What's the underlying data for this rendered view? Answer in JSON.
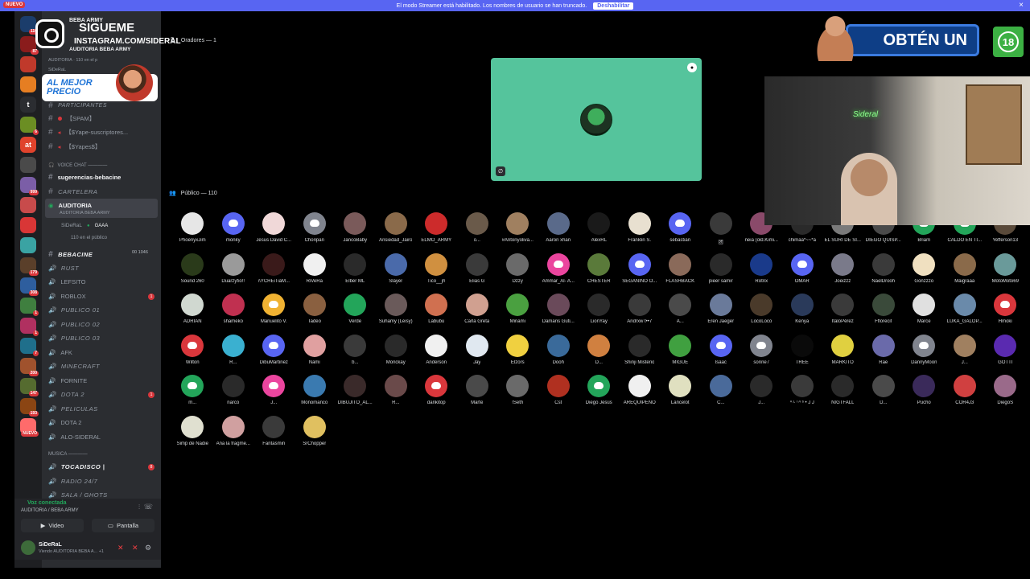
{
  "banner": {
    "badge": "NUEVO",
    "message": "El modo Streamer está habilitado. Los nombres de usuario se han truncado.",
    "button": "Deshabilitar"
  },
  "servers": [
    {
      "color": "#1b3d6b",
      "badge": "110"
    },
    {
      "color": "#8a1c1c",
      "badge": "87"
    },
    {
      "color": "#c0392b",
      "badge": ""
    },
    {
      "color": "#e67e22",
      "badge": ""
    },
    {
      "color": "#2b2d31",
      "glyph": "t",
      "badge": ""
    },
    {
      "color": "#6b8e23",
      "badge": "6"
    },
    {
      "color": "#e0432c",
      "glyph": "at",
      "badge": ""
    },
    {
      "color": "#4a4a4a",
      "badge": ""
    },
    {
      "color": "#7b5ea7",
      "badge": "999"
    },
    {
      "color": "#c84b4b",
      "badge": ""
    },
    {
      "color": "#d93636",
      "badge": ""
    },
    {
      "color": "#3aa3a3",
      "badge": ""
    },
    {
      "color": "#5a3f2a",
      "badge": "179"
    },
    {
      "color": "#2e5e9e",
      "badge": "308"
    },
    {
      "color": "#3f7f3f",
      "badge": "1"
    },
    {
      "color": "#b03060",
      "badge": "1"
    },
    {
      "color": "#1f6f8b",
      "badge": "7"
    },
    {
      "color": "#a0522d",
      "badge": "200"
    },
    {
      "color": "#556b2f",
      "badge": "147"
    },
    {
      "color": "#8b4513",
      "badge": "193"
    },
    {
      "color": "#ff6b6b",
      "badge": "NUEVO"
    }
  ],
  "overlay": {
    "follow": "SIGUEME",
    "instagram": "INSTAGRAM.COM/SIDERAL",
    "promo": "AL MEJOR PRECIO",
    "get": "OBTÉN UN",
    "age": "18"
  },
  "channels": {
    "server_name": "BEBA ARMY",
    "auditoria": "AUDITORIA BEBA ARMY",
    "auditoria_sub": "AUDITORIA  ·  110 en el p",
    "sideral": "SiDeRaL",
    "participantes": "PARTICIPANTES",
    "spam": "【SPAM】",
    "yape_subs": "【$Yape-suscriptores...",
    "yapes": "【$Yapes$】",
    "voice_cat": "VOICE CHAT ————",
    "sugerencias": "sugerencias-bebacine",
    "cartelera": "CARTELERA",
    "auditoria_ch": "AUDITORIA",
    "auditoria_ch_sub": "AUDITORIA BEBA ARMY",
    "sideral_user": "SiDeRaL",
    "gaaa": "GAAA",
    "public_count": "110 en el público",
    "bebacine": "BEBACINE",
    "bebacine_badge": "00",
    "bebacine_count": "1046",
    "rust": "RUST",
    "lefsito": "LEFSITO",
    "roblox": "ROBLOX",
    "publico1": "PUBLICO 01",
    "publico2": "PUBLICO 02",
    "publico3": "PUBLICO 03",
    "afk": "AFK",
    "minecraft": "MINECRAFT",
    "fornite": "FORNITE",
    "dota2": "DOTA 2",
    "peliculas": "PELICULAS",
    "dota2b": "DOTA 2",
    "alo": "ALO-SIDERAL",
    "musica_cat": "MUSICA ————",
    "tocadisco": "TOCADISCO |",
    "tocadisco_badge": "8",
    "radio": "RADIO 24/7",
    "sala": "SALA / GHOTS"
  },
  "voice": {
    "connected": "Voz conectada",
    "location": "AUDITORIA / BEBA ARMY",
    "video": "Video",
    "screen": "Pantalla"
  },
  "user": {
    "name": "SiDeRaL",
    "status": "Viendo AUDITORIA BEBA A...  +1"
  },
  "stage": {
    "speakers_label": "Oradores — 1",
    "public_label": "Público — 110",
    "card_color": "#55c49c"
  },
  "members": [
    {
      "name": "PhoenyxJim",
      "c": "#e6e6e6"
    },
    {
      "name": "monky",
      "c": "#5865f2",
      "d": true
    },
    {
      "name": "Jesus David C...",
      "c": "#f0d8d8"
    },
    {
      "name": "Choripan",
      "c": "#80848e",
      "d": true
    },
    {
      "name": "JancoBaby",
      "c": "#7a5a5a"
    },
    {
      "name": "Ansiedad_Jairo",
      "c": "#8a6a4a"
    },
    {
      "name": "ELMO_ARMY",
      "c": "#cc2b2b"
    },
    {
      "name": "o...",
      "c": "#6a5a4a"
    },
    {
      "name": "#Antonyoliva...",
      "c": "#a08060"
    },
    {
      "name": "Aaron xhan",
      "c": "#5a6a8a"
    },
    {
      "name": "AlexRL",
      "c": "#1a1a1a"
    },
    {
      "name": "Franklin S.",
      "c": "#e8e0d0"
    },
    {
      "name": "sebastian",
      "c": "#5865f2",
      "d": true
    },
    {
      "name": "团",
      "c": "#3a3a3a"
    },
    {
      "name": "neia (old.Kimi...",
      "c": "#8a4a6a"
    },
    {
      "name": "chimaa*~~*a",
      "c": "#2a2a2a"
    },
    {
      "name": "EL SURI DE SI...",
      "c": "#7a7a7a"
    },
    {
      "name": "DIEGO QUISP...",
      "c": "#4a4a4a"
    },
    {
      "name": "Briam",
      "c": "#23a55a",
      "d": true
    },
    {
      "name": "CALDO EN TI...",
      "c": "#23a55a",
      "d": true
    },
    {
      "name": "Yefferson13",
      "c": "#5a4a3a"
    },
    {
      "name": "Sound 260",
      "c": "#2a3a1a"
    },
    {
      "name": "Duarzyfio!!",
      "c": "#9a9a9a"
    },
    {
      "name": "\\\\YCHEiTiaM...",
      "c": "#3a1a1a"
    },
    {
      "name": "RiVeRa",
      "c": "#f0f0f0"
    },
    {
      "name": "Elber ML",
      "c": "#2a2a2a"
    },
    {
      "name": "Slayer",
      "c": "#4a6aaa"
    },
    {
      "name": "Tico__jh",
      "c": "#d09040"
    },
    {
      "name": "Elias G",
      "c": "#3a3a3a"
    },
    {
      "name": "Dzzy",
      "c": "#6a6a6a"
    },
    {
      "name": "Ammar_Al- A...",
      "c": "#eb459e",
      "d": true
    },
    {
      "name": "CHESTER",
      "c": "#5a7a3a"
    },
    {
      "name": "SEGANINO O...",
      "c": "#5865f2",
      "d": true
    },
    {
      "name": "FLASHBACK",
      "c": "#8a6a5a"
    },
    {
      "name": "pieer samir",
      "c": "#2a2a2a"
    },
    {
      "name": "Rotrix",
      "c": "#1a3a8a"
    },
    {
      "name": "OMAR",
      "c": "#5865f2",
      "d": true
    },
    {
      "name": "Joeizzz",
      "c": "#7a7a8a"
    },
    {
      "name": "NaelDrooh",
      "c": "#3a3a3a"
    },
    {
      "name": "Gonzzzo",
      "c": "#f0e0c0"
    },
    {
      "name": "Maigraaa",
      "c": "#8a6a4a"
    },
    {
      "name": "MotoMoto69",
      "c": "#6a9a9a"
    },
    {
      "name": "ADRIAN",
      "c": "#d0d8d0"
    },
    {
      "name": "shameko",
      "c": "#c03050"
    },
    {
      "name": "Manuelito V.",
      "c": "#f0b232",
      "d": true
    },
    {
      "name": "Tadeo",
      "c": "#8a6040"
    },
    {
      "name": "Verde",
      "c": "#23a55a"
    },
    {
      "name": "Suhamy (Leisy)",
      "c": "#6a5a5a"
    },
    {
      "name": "Labubu",
      "c": "#d07050"
    },
    {
      "name": "Carla Greta",
      "c": "#d0a090"
    },
    {
      "name": "Minami",
      "c": "#4aa040"
    },
    {
      "name": "Damaris Guti...",
      "c": "#6a4a5a"
    },
    {
      "name": "LionYay",
      "c": "#2a2a2a"
    },
    {
      "name": "Andrxw t••7",
      "c": "#3a3a3a"
    },
    {
      "name": "A...",
      "c": "#4a4a4a"
    },
    {
      "name": "Eren Jaeger",
      "c": "#6a7a9a"
    },
    {
      "name": "LocoLoco",
      "c": "#4a3a2a"
    },
    {
      "name": "Kenya",
      "c": "#2a3a5a"
    },
    {
      "name": "ItaloPérez",
      "c": "#3a3a3a"
    },
    {
      "name": "Fflorecit",
      "c": "#3a4a3a"
    },
    {
      "name": "Marce",
      "c": "#e0e0e0"
    },
    {
      "name": "LUKA_GALOP...",
      "c": "#6a8aaa"
    },
    {
      "name": "Hmoki",
      "c": "#da373c",
      "d": true
    },
    {
      "name": "Wilton",
      "c": "#da373c",
      "d": true
    },
    {
      "name": "R...",
      "c": "#3ab0d0"
    },
    {
      "name": "DibuMartinez",
      "c": "#5865f2",
      "d": true
    },
    {
      "name": "Nami",
      "c": "#e0a0a0"
    },
    {
      "name": "b...",
      "c": "#3a3a3a"
    },
    {
      "name": "Monckay",
      "c": "#2a2a2a"
    },
    {
      "name": "Anderson",
      "c": "#f0f0f0"
    },
    {
      "name": "Jay",
      "c": "#e0e8f0"
    },
    {
      "name": "Elzors",
      "c": "#f0d040"
    },
    {
      "name": "Dooh",
      "c": "#3a6a9a"
    },
    {
      "name": "D...",
      "c": "#d08040"
    },
    {
      "name": "Shinji Misterio",
      "c": "#2a2a2a"
    },
    {
      "name": "MIGUE",
      "c": "#40a040"
    },
    {
      "name": "Isaac",
      "c": "#5865f2",
      "d": true
    },
    {
      "name": "sonne7",
      "c": "#80848e",
      "d": true
    },
    {
      "name": "TREE",
      "c": "#0a0a0a"
    },
    {
      "name": "MARKITO",
      "c": "#e0d040"
    },
    {
      "name": "Rae",
      "c": "#6a6aaa"
    },
    {
      "name": "DannyMoon",
      "c": "#80848e",
      "d": true
    },
    {
      "name": "J...",
      "c": "#a08060"
    },
    {
      "name": "GOTTI",
      "c": "#5a2ab0"
    },
    {
      "name": "m...",
      "c": "#23a55a",
      "d": true
    },
    {
      "name": "narco",
      "c": "#2a2a2a"
    },
    {
      "name": "J...",
      "c": "#eb459e",
      "d": true
    },
    {
      "name": "Monomanco",
      "c": "#3a7ab0"
    },
    {
      "name": "DIBUJITO_AL...",
      "c": "#3a2a2a"
    },
    {
      "name": "R...",
      "c": "#6a4a4a"
    },
    {
      "name": "dankitop",
      "c": "#da373c",
      "d": true
    },
    {
      "name": "Marte",
      "c": "#4a4a4a"
    },
    {
      "name": "!Seth",
      "c": "#6a6a6a"
    },
    {
      "name": "Cst",
      "c": "#b03020"
    },
    {
      "name": "Diego Jesús",
      "c": "#23a55a",
      "d": true
    },
    {
      "name": "AREQUIPEÑO",
      "c": "#f0f0f0"
    },
    {
      "name": "Lancelot",
      "c": "#e0e0c0"
    },
    {
      "name": "C...",
      "c": "#4a6a9a"
    },
    {
      "name": "J...",
      "c": "#2a2a2a"
    },
    {
      "name": "ᴬ ᴸ ᴵ ᴬ ˢ • J J",
      "c": "#3a3a3a"
    },
    {
      "name": "NIGTFALL",
      "c": "#2a2a2a"
    },
    {
      "name": "D...",
      "c": "#4a4a4a"
    },
    {
      "name": "Pucho",
      "c": "#3a2a5a"
    },
    {
      "name": "COR4J3",
      "c": "#d04040"
    },
    {
      "name": "DiegoS",
      "c": "#9a6a8a"
    },
    {
      "name": "Simp de Nadie",
      "c": "#e0e0d0"
    },
    {
      "name": "Ana la fragme...",
      "c": "#d0a0a0"
    },
    {
      "name": "Fantasmin",
      "c": "#3a3a3a"
    },
    {
      "name": "SrChopper",
      "c": "#e0c060"
    }
  ]
}
